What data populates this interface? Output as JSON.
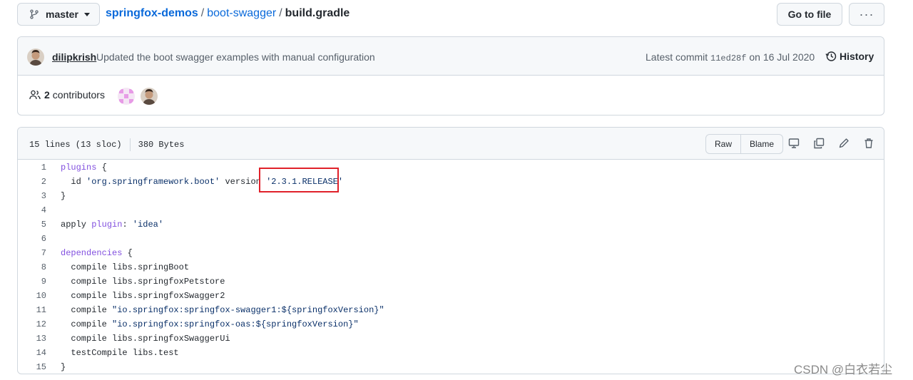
{
  "topbar": {
    "branch": "master",
    "repo": "springfox-demos",
    "folder": "boot-swagger",
    "separator": "/",
    "file": "build.gradle",
    "goto_file": "Go to file",
    "more": "···"
  },
  "commit": {
    "author": "dilipkrish",
    "message": "Updated the boot swagger examples with manual configuration",
    "latest_label": "Latest commit",
    "sha": "11ed28f",
    "date_prefix": "on",
    "date": "16 Jul 2020",
    "history": "History"
  },
  "contributors": {
    "count": "2",
    "label": "contributors"
  },
  "file": {
    "lines_info": "15 lines (13 sloc)",
    "size": "380 Bytes",
    "raw": "Raw",
    "blame": "Blame"
  },
  "code_lines": [
    {
      "num": "1",
      "text": "plugins {"
    },
    {
      "num": "2",
      "text": "  id 'org.springframework.boot' version '2.3.1.RELEASE'"
    },
    {
      "num": "3",
      "text": "}"
    },
    {
      "num": "4",
      "text": ""
    },
    {
      "num": "5",
      "text": "apply plugin: 'idea'"
    },
    {
      "num": "6",
      "text": ""
    },
    {
      "num": "7",
      "text": "dependencies {"
    },
    {
      "num": "8",
      "text": "  compile libs.springBoot"
    },
    {
      "num": "9",
      "text": "  compile libs.springfoxPetstore"
    },
    {
      "num": "10",
      "text": "  compile libs.springfoxSwagger2"
    },
    {
      "num": "11",
      "text": "  compile \"io.springfox:springfox-swagger1:${springfoxVersion}\""
    },
    {
      "num": "12",
      "text": "  compile \"io.springfox:springfox-oas:${springfoxVersion}\""
    },
    {
      "num": "13",
      "text": "  compile libs.springfoxSwaggerUi"
    },
    {
      "num": "14",
      "text": "  testCompile libs.test"
    },
    {
      "num": "15",
      "text": "}"
    }
  ],
  "watermark": "CSDN @白衣若尘",
  "colors": {
    "link": "#0969da",
    "keyword": "#8250df",
    "string": "#0a3069",
    "highlight_box": "#e0212a"
  },
  "icons": [
    "git-branch-icon",
    "history-icon",
    "people-icon",
    "desktop-icon",
    "copy-icon",
    "pencil-icon",
    "trash-icon"
  ]
}
